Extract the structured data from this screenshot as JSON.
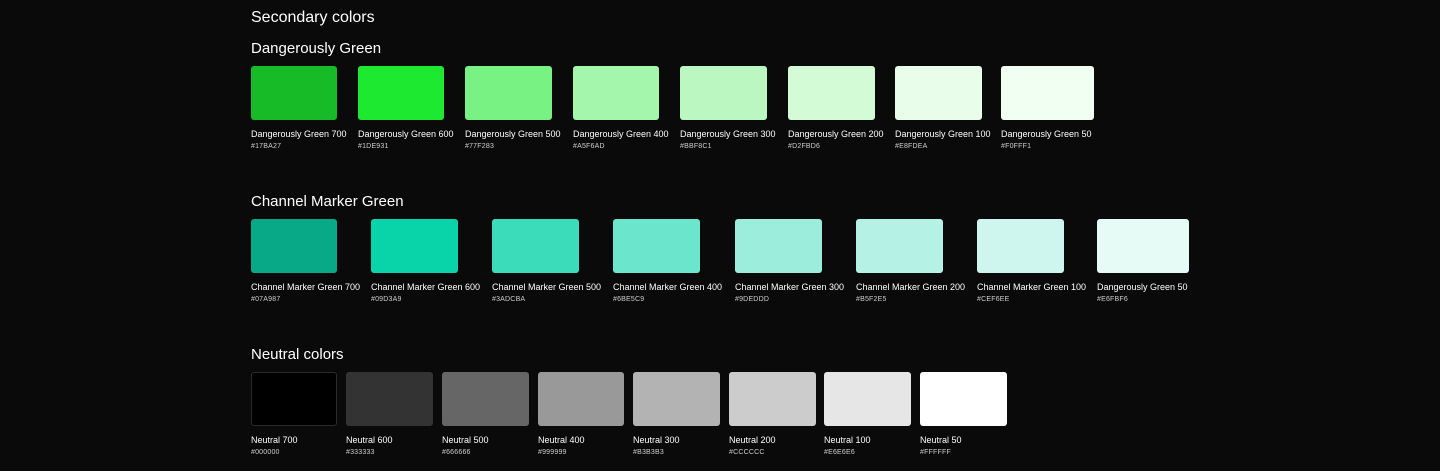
{
  "page_title": "Secondary colors",
  "sections": [
    {
      "title": "Dangerously Green",
      "swatches": [
        {
          "name": "Dangerously Green 700",
          "hex": "#17BA27",
          "color": "#17BA27"
        },
        {
          "name": "Dangerously Green 600",
          "hex": "#1DE931",
          "color": "#1DE931"
        },
        {
          "name": "Dangerously Green 500",
          "hex": "#77F283",
          "color": "#77F283"
        },
        {
          "name": "Dangerously Green 400",
          "hex": "#A5F6AD",
          "color": "#A5F6AD"
        },
        {
          "name": "Dangerously Green 300",
          "hex": "#BBF8C1",
          "color": "#BBF8C1"
        },
        {
          "name": "Dangerously Green 200",
          "hex": "#D2FBD6",
          "color": "#D2FBD6"
        },
        {
          "name": "Dangerously Green 100",
          "hex": "#E8FDEA",
          "color": "#E8FDEA"
        },
        {
          "name": "Dangerously Green 50",
          "hex": "#F0FFF1",
          "color": "#F0FFF1"
        }
      ]
    },
    {
      "title": "Channel Marker Green",
      "swatches": [
        {
          "name": "Channel Marker Green 700",
          "hex": "#07A987",
          "color": "#07A987"
        },
        {
          "name": "Channel Marker Green 600",
          "hex": "#09D3A9",
          "color": "#09D3A9"
        },
        {
          "name": "Channel Marker Green 500",
          "hex": "#3ADCBA",
          "color": "#3ADCBA"
        },
        {
          "name": "Channel Marker Green 400",
          "hex": "#6BE5C9",
          "color": "#6BE5CB"
        },
        {
          "name": "Channel Marker Green 300",
          "hex": "#9DEDDD",
          "color": "#9DEDDD"
        },
        {
          "name": "Channel Marker Green 200",
          "hex": "#B5F2E5",
          "color": "#B5F2E5"
        },
        {
          "name": "Channel Marker Green 100",
          "hex": "#CEF6EE",
          "color": "#CEF6EE"
        },
        {
          "name": "Dangerously Green 50",
          "hex": "#E6FBF6",
          "color": "#E6FBF6"
        }
      ]
    },
    {
      "title": "Neutral colors",
      "swatches": [
        {
          "name": "Neutral 700",
          "hex": "#000000",
          "color": "#000000"
        },
        {
          "name": "Neutral 600",
          "hex": "#333333",
          "color": "#333333"
        },
        {
          "name": "Neutral 500",
          "hex": "#666666",
          "color": "#666666"
        },
        {
          "name": "Neutral 400",
          "hex": "#999999",
          "color": "#999999"
        },
        {
          "name": "Neutral 300",
          "hex": "#B3B3B3",
          "color": "#B3B3B3"
        },
        {
          "name": "Neutral 200",
          "hex": "#CCCCCC",
          "color": "#CCCCCC"
        },
        {
          "name": "Neutral 100",
          "hex": "#E6E6E6",
          "color": "#E6E6E6"
        },
        {
          "name": "Neutral 50",
          "hex": "#FFFFFF",
          "color": "#FFFFFF"
        }
      ]
    }
  ]
}
